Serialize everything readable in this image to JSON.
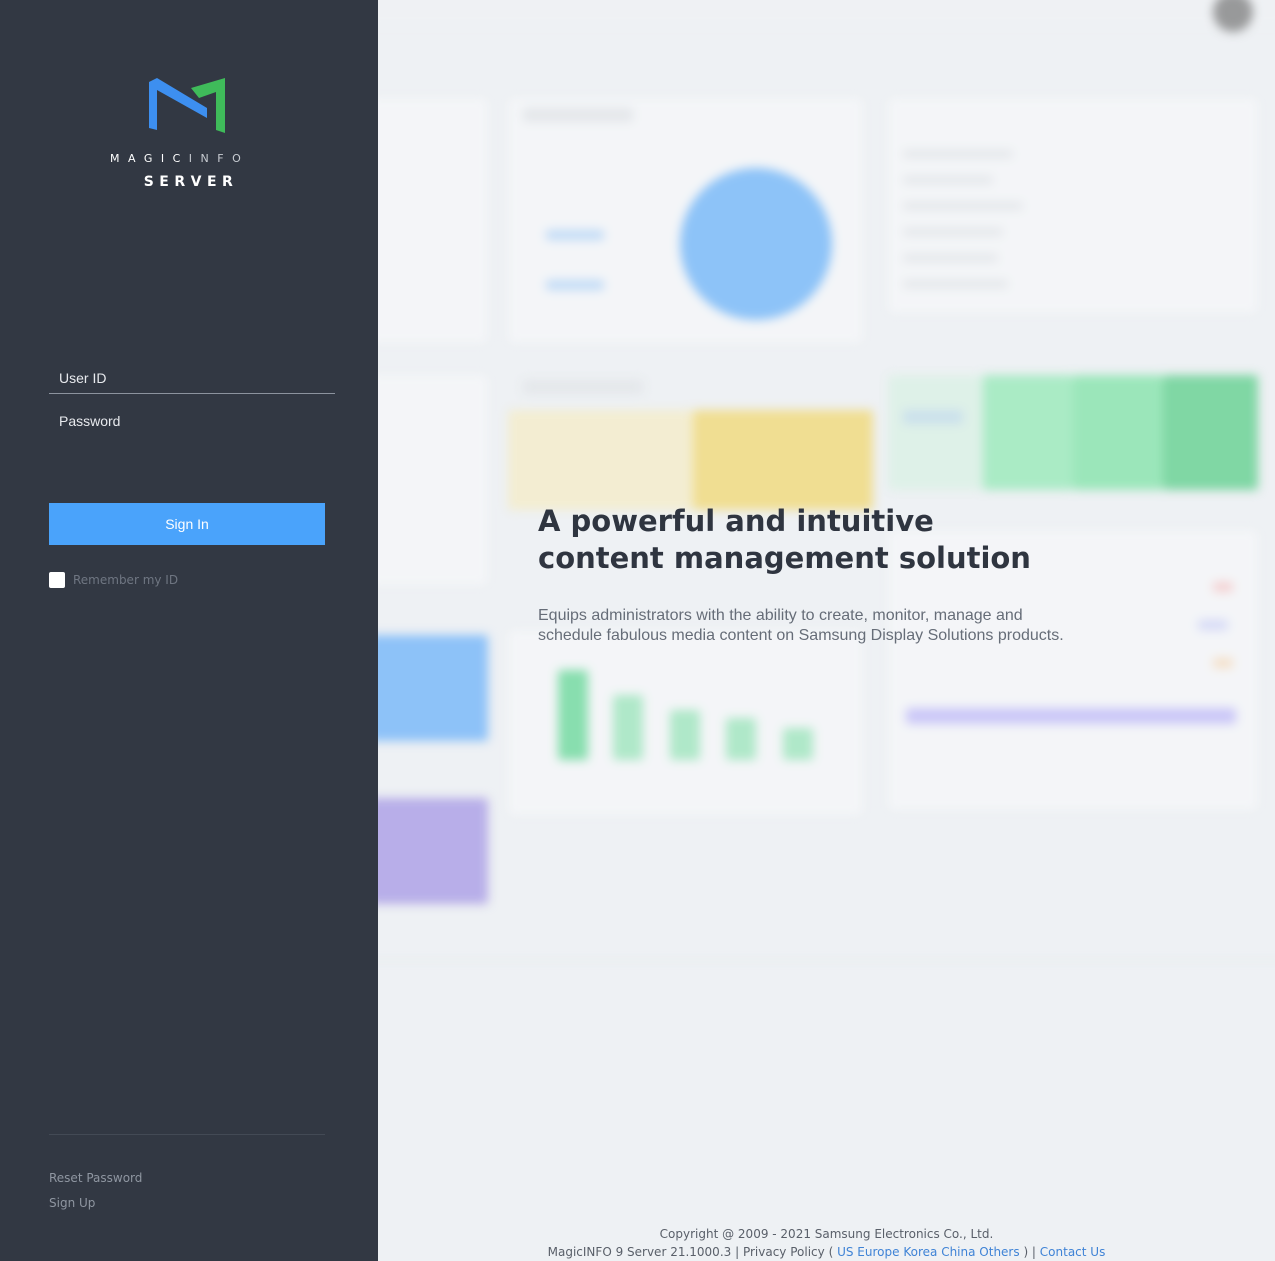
{
  "brand": {
    "logo_word_magic": "MAGIC",
    "logo_word_info": "INFO",
    "logo_sub": "SERVER",
    "colors": {
      "blue": "#3d8ff0",
      "green": "#3fbb5a"
    }
  },
  "login": {
    "user_id_placeholder": "User ID",
    "password_placeholder": "Password",
    "sign_in_label": "Sign In",
    "remember_label": "Remember my ID",
    "remember_checked": false,
    "accent": "#4aa3fb"
  },
  "side_links": {
    "reset_password": "Reset Password",
    "sign_up": "Sign Up"
  },
  "hero": {
    "title": "A powerful and intuitive content management solution",
    "description": "Equips administrators with the ability to create, monitor, manage and schedule fabulous media content on Samsung Display Solutions products."
  },
  "footer": {
    "copyright": "Copyright @ 2009 - 2021 Samsung Electronics Co., Ltd.",
    "version": "MagicINFO 9 Server 21.1000.3",
    "privacy": "Privacy Policy",
    "regions": [
      "US",
      "Europe",
      "Korea",
      "China",
      "Others"
    ],
    "contact": "Contact Us"
  }
}
